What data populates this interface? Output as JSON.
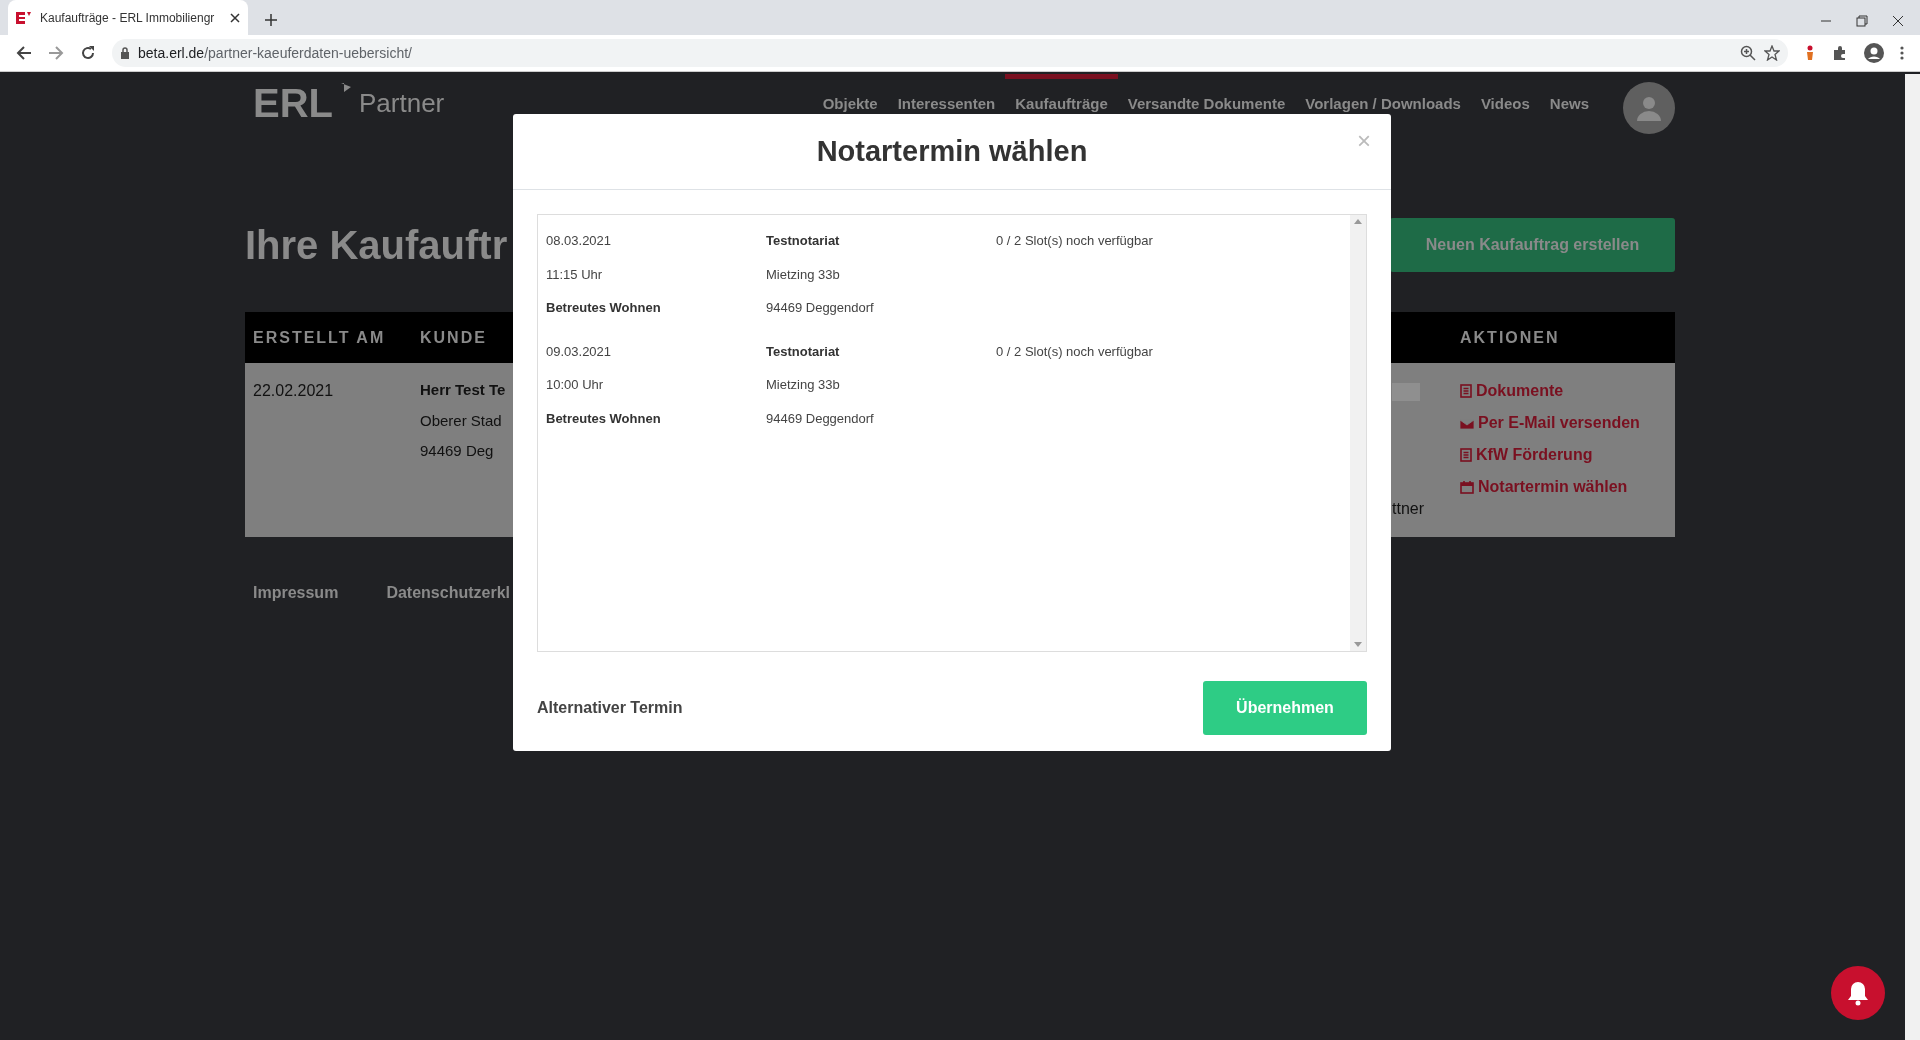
{
  "browser": {
    "tab_title": "Kaufaufträge - ERL Immobiliengr",
    "url_host": "beta.erl.de",
    "url_path": "/partner-kaeuferdaten-uebersicht/"
  },
  "header": {
    "logo": "ERL",
    "logo_sub": "Partner",
    "nav": [
      {
        "label": "Objekte",
        "selected": false
      },
      {
        "label": "Interessenten",
        "selected": false
      },
      {
        "label": "Kaufaufträge",
        "selected": true
      },
      {
        "label": "Versandte Dokumente",
        "selected": false
      },
      {
        "label": "Vorlagen / Downloads",
        "selected": false
      },
      {
        "label": "Videos",
        "selected": false
      },
      {
        "label": "News",
        "selected": false
      }
    ]
  },
  "page": {
    "title": "Ihre Kaufauftr",
    "new_button": "Neuen Kaufauftrag erstellen",
    "table": {
      "columns": [
        "ERSTELLT AM",
        "KUNDE",
        "AKTIONEN"
      ],
      "rows": [
        {
          "created": "22.02.2021",
          "customer": [
            "Herr Test Te",
            "Oberer Stad",
            "94469 Deg"
          ],
          "partial_text": "ttner",
          "actions": [
            {
              "kind": "document",
              "label": "Dokumente"
            },
            {
              "kind": "email",
              "label": "Per E-Mail versenden"
            },
            {
              "kind": "document",
              "label": "KfW Förderung"
            },
            {
              "kind": "calendar",
              "label": "Notartermin wählen"
            }
          ]
        }
      ]
    }
  },
  "footer": {
    "links": [
      "Impressum",
      "Datenschutzerkl"
    ]
  },
  "modal": {
    "title": "Notartermin wählen",
    "close": "×",
    "appointments": [
      {
        "date": "08.03.2021",
        "notary": "Testnotariat",
        "availability": "0 / 2 Slot(s) noch verfügbar",
        "time": "11:15 Uhr",
        "street": "Mietzing 33b",
        "object": "Betreutes Wohnen",
        "city": "94469 Deggendorf"
      },
      {
        "date": "09.03.2021",
        "notary": "Testnotariat",
        "availability": "0 / 2 Slot(s) noch verfügbar",
        "time": "10:00 Uhr",
        "street": "Mietzing 33b",
        "object": "Betreutes Wohnen",
        "city": "94469 Deggendorf"
      }
    ],
    "alternative": "Alternativer Termin",
    "submit": "Übernehmen"
  }
}
